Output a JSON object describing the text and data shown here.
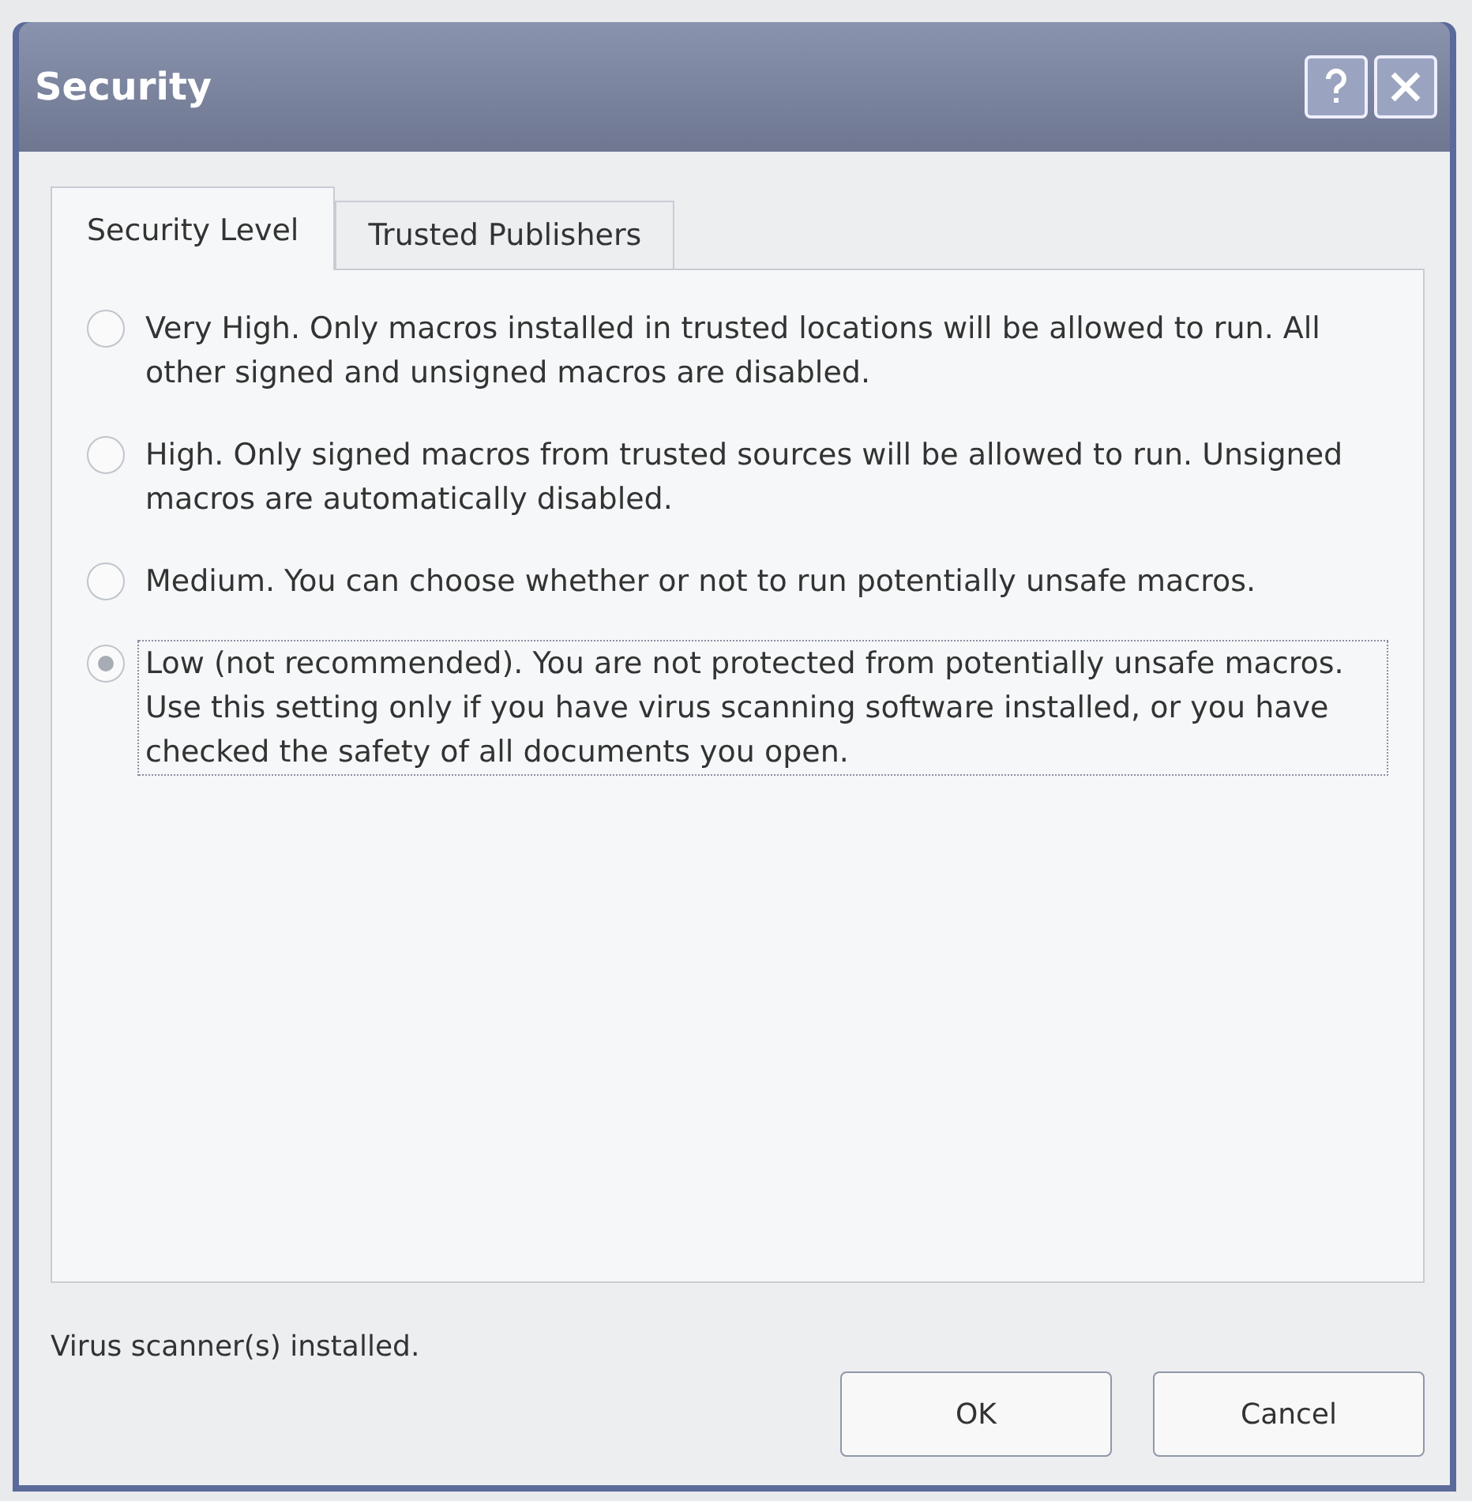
{
  "window": {
    "title": "Security"
  },
  "tabs": [
    {
      "label": "Security Level",
      "selected": true
    },
    {
      "label": "Trusted Publishers",
      "selected": false
    }
  ],
  "options": [
    {
      "label": "Very High. Only macros installed in trusted locations will be allowed to run. All other signed and unsigned macros are disabled.",
      "selected": false
    },
    {
      "label": "High. Only signed macros from trusted sources will be allowed to run. Unsigned macros are automatically disabled.",
      "selected": false
    },
    {
      "label": "Medium. You can choose whether or not to run potentially unsafe macros.",
      "selected": false
    },
    {
      "label": "Low (not recommended). You are not protected from potentially unsafe macros. Use this setting only if you have virus scanning software installed, or you have checked the safety of all documents you open.",
      "selected": true
    }
  ],
  "status": "Virus scanner(s) installed.",
  "buttons": [
    "OK",
    "Cancel"
  ]
}
